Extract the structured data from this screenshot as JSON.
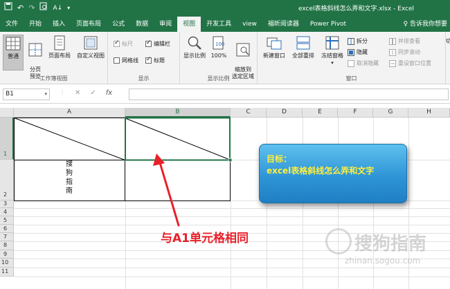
{
  "titlebar": {
    "title": "excel表格斜线怎么弄和文字.xlsx  -  Excel",
    "qat": [
      "save-icon",
      "undo-icon",
      "redo-icon",
      "print-preview-icon",
      "sort-icon",
      "customize-icon"
    ]
  },
  "tabs": [
    {
      "label": "文件"
    },
    {
      "label": "开始"
    },
    {
      "label": "插入"
    },
    {
      "label": "页面布局"
    },
    {
      "label": "公式"
    },
    {
      "label": "数据"
    },
    {
      "label": "审阅"
    },
    {
      "label": "视图"
    },
    {
      "label": "开发工具"
    },
    {
      "label": "view"
    },
    {
      "label": "福昕阅读器"
    },
    {
      "label": "Power Pivot"
    }
  ],
  "tell_me": "♀ 告诉我你想要",
  "ribbon": {
    "workbook_views": {
      "label": "工作簿视图",
      "normal": "普通",
      "page_break": "分页\n预览",
      "page_layout": "页面布局",
      "custom": "自定义视图"
    },
    "show": {
      "label": "显示",
      "ruler": "标尺",
      "formula_bar": "编辑栏",
      "gridlines": "网格线",
      "headings": "标题"
    },
    "zoom": {
      "label": "显示比例",
      "zoom": "显示比例",
      "zoom100": "100%",
      "zoom_sel": "缩放到\n选定区域"
    },
    "window": {
      "label": "窗口",
      "new_window": "新建窗口",
      "arrange_all": "全部重排",
      "freeze": "冻结窗格",
      "split": "拆分",
      "hide": "隐藏",
      "unhide": "取消隐藏",
      "side_by_side": "并排查看",
      "sync_scroll": "同步滚动",
      "reset_pos": "重设窗口位置",
      "switch": "切"
    }
  },
  "formula_bar": {
    "name_box": "B1",
    "cancel": "✕",
    "enter": "✓",
    "fx": "fx",
    "value": ""
  },
  "grid": {
    "columns": [
      "A",
      "B",
      "C",
      "D",
      "E",
      "F",
      "G",
      "H"
    ],
    "rows": [
      "1",
      "2",
      "3",
      "4",
      "5",
      "6",
      "7",
      "8",
      "9",
      "10",
      "11"
    ],
    "a2_text": "搜\n狗\n指\n南"
  },
  "callout": {
    "title": "目标：",
    "body": "excel表格斜线怎么弄和文字"
  },
  "annotation": "与A1单元格相同",
  "watermark": {
    "name": "搜狗指南",
    "url": "zhinan.sogou.com"
  },
  "colors": {
    "excel_green": "#217346",
    "arrow_red": "#e8202a",
    "callout_text": "#ffef3a",
    "callout_bg": "#2f95d6"
  }
}
